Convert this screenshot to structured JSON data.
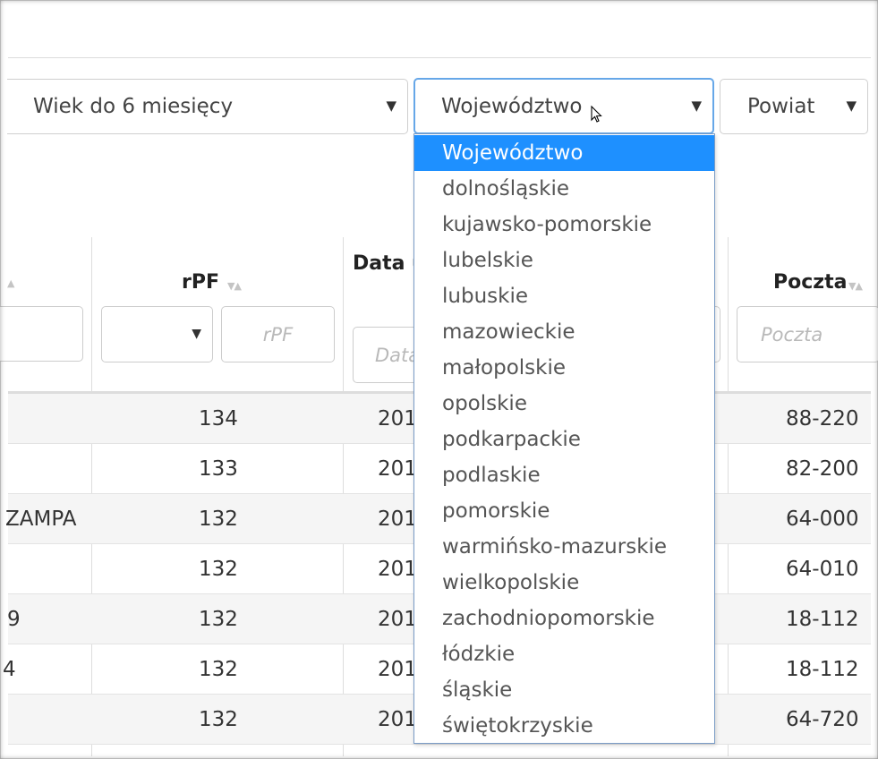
{
  "filters": {
    "age_select": "Wiek do 6 miesięcy",
    "voivodeship_select": "Województwo",
    "county_select": "Powiat"
  },
  "table": {
    "headers": {
      "rpf": "rPF",
      "date": "Data u",
      "post": "Poczta"
    },
    "placeholders": {
      "rpf": "rPF",
      "date": "Data",
      "post": "Poczta"
    },
    "rows": [
      {
        "left": "",
        "rpf": "134",
        "date": "201",
        "post": "88-220"
      },
      {
        "left": "",
        "rpf": "133",
        "date": "201",
        "post": "82-200"
      },
      {
        "left": "ZAMPA",
        "rpf": "132",
        "date": "201",
        "post": "64-000"
      },
      {
        "left": "",
        "rpf": "132",
        "date": "201",
        "post": "64-010"
      },
      {
        "left": "9",
        "rpf": "132",
        "date": "201",
        "post": "18-112"
      },
      {
        "left": "4",
        "rpf": "132",
        "date": "201",
        "post": "18-112"
      },
      {
        "left": "",
        "rpf": "132",
        "date": "201",
        "post": "64-720"
      }
    ]
  },
  "dropdown": {
    "options": [
      "Województwo",
      "dolnośląskie",
      "kujawsko-pomorskie",
      "lubelskie",
      "lubuskie",
      "mazowieckie",
      "małopolskie",
      "opolskie",
      "podkarpackie",
      "podlaskie",
      "pomorskie",
      "warmińsko-mazurskie",
      "wielkopolskie",
      "zachodniopomorskie",
      "łódzkie",
      "śląskie",
      "świętokrzyskie"
    ],
    "selected_index": 0
  },
  "icons": {
    "caret": "caret-down-icon",
    "sort": "sort-arrows-icon",
    "cursor": "mouse-pointer-icon"
  },
  "colors": {
    "selected_option_bg": "#1e90ff",
    "focus_border": "#66a7e8",
    "stripe": "#f5f5f5"
  }
}
